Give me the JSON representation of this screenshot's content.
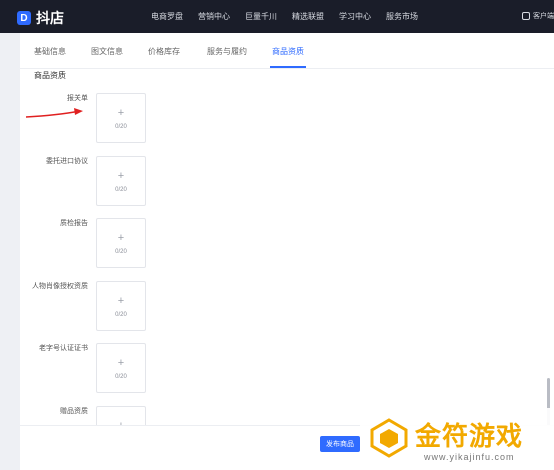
{
  "topbar": {
    "logo_text": "抖店",
    "nav": [
      "电商罗盘",
      "营销中心",
      "巨量千川",
      "精选联盟",
      "学习中心",
      "服务市场"
    ],
    "support_label": "客户端"
  },
  "tabs": [
    {
      "label": "基础信息",
      "active": false
    },
    {
      "label": "图文信息",
      "active": false
    },
    {
      "label": "价格库存",
      "active": false
    },
    {
      "label": "服务与履约",
      "active": false
    },
    {
      "label": "商品资质",
      "active": true
    }
  ],
  "section_title": "商品资质",
  "qualifications": [
    {
      "label": "报关单",
      "plus": "+",
      "count": "0/20"
    },
    {
      "label": "委托进口协议",
      "plus": "+",
      "count": "0/20"
    },
    {
      "label": "质检报告",
      "plus": "+",
      "count": "0/20"
    },
    {
      "label": "人物肖像授权资质",
      "plus": "+",
      "count": "0/20"
    },
    {
      "label": "老字号认证证书",
      "plus": "+",
      "count": "0/20"
    },
    {
      "label": "赠品资质",
      "plus": "+",
      "count": ""
    }
  ],
  "footer": {
    "publish_label": "发布商品"
  },
  "watermark": {
    "text": "金符游戏",
    "url": "www.yikajinfu.com"
  },
  "colors": {
    "accent": "#2f6bff",
    "topbar": "#1a1d29",
    "arrow": "#e02020",
    "watermark": "#f2a900"
  }
}
